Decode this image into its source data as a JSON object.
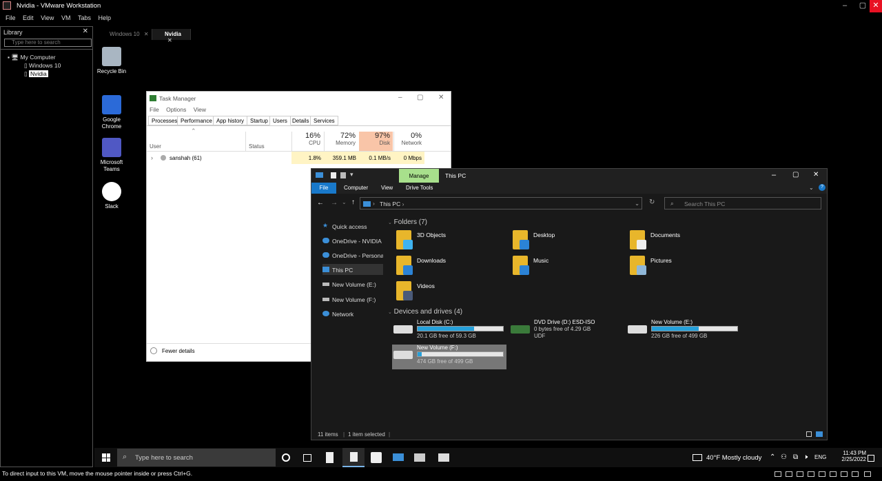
{
  "window": {
    "title": "Nvidia - VMware Workstation"
  },
  "menu": [
    "File",
    "Edit",
    "View",
    "VM",
    "Tabs",
    "Help"
  ],
  "library": {
    "title": "Library",
    "search_placeholder": "Type here to search",
    "tree": {
      "root": "My Computer",
      "vms": [
        "Windows 10",
        "Nvidia"
      ]
    }
  },
  "vm_tabs": [
    {
      "label": "Windows 10"
    },
    {
      "label": "Nvidia"
    }
  ],
  "desktop_icons": [
    {
      "label": "Recycle Bin"
    },
    {
      "label": "Google Chrome"
    },
    {
      "label": "Microsoft Teams"
    },
    {
      "label": "Slack"
    }
  ],
  "task_manager": {
    "title": "Task Manager",
    "menu": [
      "File",
      "Options",
      "View"
    ],
    "tabs": [
      "Processes",
      "Performance",
      "App history",
      "Startup",
      "Users",
      "Details",
      "Services"
    ],
    "active_tab": "Users",
    "columns": {
      "user": "User",
      "status": "Status",
      "cpu": {
        "pct": "16%",
        "label": "CPU"
      },
      "memory": {
        "pct": "72%",
        "label": "Memory"
      },
      "disk": {
        "pct": "97%",
        "label": "Disk"
      },
      "network": {
        "pct": "0%",
        "label": "Network"
      }
    },
    "row": {
      "user": "sanshah (61)",
      "cpu": "1.8%",
      "memory": "359.1 MB",
      "disk": "0.1 MB/s",
      "network": "0 Mbps"
    },
    "fewer_details": "Fewer details"
  },
  "explorer": {
    "title": "This PC",
    "manage": "Manage",
    "ribbon": [
      "File",
      "Computer",
      "View",
      "Drive Tools"
    ],
    "path": "This PC",
    "search_placeholder": "Search This PC",
    "nav": [
      "Quick access",
      "OneDrive - NVIDIA C",
      "OneDrive - Personal",
      "This PC",
      "New Volume (E:)",
      "New Volume (F:)",
      "Network"
    ],
    "folders_header": "Folders (7)",
    "folders": [
      "3D Objects",
      "Desktop",
      "Documents",
      "Downloads",
      "Music",
      "Pictures",
      "Videos"
    ],
    "drives_header": "Devices and drives (4)",
    "drives": [
      {
        "name": "Local Disk (C:)",
        "free": "20.1 GB free of 59.3 GB",
        "used_fraction": 0.66
      },
      {
        "name": "DVD Drive (D:) ESD-ISO",
        "free": "0 bytes free of 4.29 GB",
        "extra": "UDF"
      },
      {
        "name": "New Volume (E:)",
        "free": "226 GB free of 499 GB",
        "used_fraction": 0.55
      },
      {
        "name": "New Volume (F:)",
        "free": "474 GB free of 499 GB",
        "used_fraction": 0.05
      }
    ],
    "status_items": "11 items",
    "status_selected": "1 item selected"
  },
  "taskbar": {
    "search": "Type here to search",
    "weather": "40°F  Mostly cloudy",
    "lang": "ENG",
    "time": "11:43 PM",
    "date": "2/25/2022"
  },
  "statusbar": "To direct input to this VM, move the mouse pointer inside or press Ctrl+G."
}
